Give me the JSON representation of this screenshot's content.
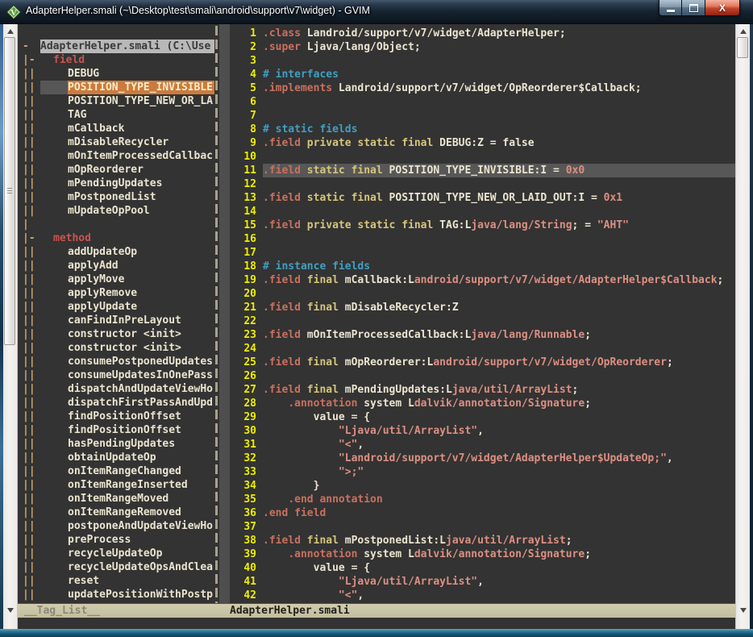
{
  "window": {
    "title": "AdapterHelper.smali (~\\Desktop\\test\\smali\\android\\support\\v7\\widget) - GVIM",
    "icon": "vim-icon",
    "buttons": {
      "minimize": "minimize",
      "maximize": "maximize",
      "close": "close"
    }
  },
  "colors": {
    "editor_bg": "#333333",
    "cursorline_bg": "#575757",
    "selected_tag_bg": "#cd7b3c",
    "statusbar_bg": "#c9c3a6",
    "line_number": "#eded00",
    "keyword": "#c9705f",
    "declaration": "#d6c57b",
    "plain_text": "#eae4cf",
    "comment": "#419ec1",
    "string_type": "#dc8f82",
    "fold_marker": "#cfa671",
    "group_label": "#c75450",
    "close_button": "#c04329"
  },
  "statusbar": {
    "left": "__Tag_List__",
    "file": "AdapterHelper.smali"
  },
  "taglist": {
    "rows": [
      {
        "fold": "-",
        "style": "header",
        "label": "AdapterHelper.smali (C:\\Use"
      },
      {
        "fold": "|-",
        "style": "group",
        "label": "field"
      },
      {
        "fold": "||",
        "style": "item",
        "label": "DEBUG"
      },
      {
        "fold": "||",
        "style": "item",
        "label": "POSITION_TYPE_INVISIBLE",
        "selected": true
      },
      {
        "fold": "||",
        "style": "item",
        "label": "POSITION_TYPE_NEW_OR_LA"
      },
      {
        "fold": "||",
        "style": "item",
        "label": "TAG"
      },
      {
        "fold": "||",
        "style": "item",
        "label": "mCallback"
      },
      {
        "fold": "||",
        "style": "item",
        "label": "mDisableRecycler"
      },
      {
        "fold": "||",
        "style": "item",
        "label": "mOnItemProcessedCallbac"
      },
      {
        "fold": "||",
        "style": "item",
        "label": "mOpReorderer"
      },
      {
        "fold": "||",
        "style": "item",
        "label": "mPendingUpdates"
      },
      {
        "fold": "||",
        "style": "item",
        "label": "mPostponedList"
      },
      {
        "fold": "||",
        "style": "item",
        "label": "mUpdateOpPool"
      },
      {
        "fold": "|",
        "style": "item",
        "label": ""
      },
      {
        "fold": "|-",
        "style": "group",
        "label": "method"
      },
      {
        "fold": "||",
        "style": "item",
        "label": "addUpdateOp"
      },
      {
        "fold": "||",
        "style": "item",
        "label": "applyAdd"
      },
      {
        "fold": "||",
        "style": "item",
        "label": "applyMove"
      },
      {
        "fold": "||",
        "style": "item",
        "label": "applyRemove"
      },
      {
        "fold": "||",
        "style": "item",
        "label": "applyUpdate"
      },
      {
        "fold": "||",
        "style": "item",
        "label": "canFindInPreLayout"
      },
      {
        "fold": "||",
        "style": "item",
        "label": "constructor <init>"
      },
      {
        "fold": "||",
        "style": "item",
        "label": "constructor <init>"
      },
      {
        "fold": "||",
        "style": "item",
        "label": "consumePostponedUpdates"
      },
      {
        "fold": "||",
        "style": "item",
        "label": "consumeUpdatesInOnePass"
      },
      {
        "fold": "||",
        "style": "item",
        "label": "dispatchAndUpdateViewHo"
      },
      {
        "fold": "||",
        "style": "item",
        "label": "dispatchFirstPassAndUpd"
      },
      {
        "fold": "||",
        "style": "item",
        "label": "findPositionOffset"
      },
      {
        "fold": "||",
        "style": "item",
        "label": "findPositionOffset"
      },
      {
        "fold": "||",
        "style": "item",
        "label": "hasPendingUpdates"
      },
      {
        "fold": "||",
        "style": "item",
        "label": "obtainUpdateOp"
      },
      {
        "fold": "||",
        "style": "item",
        "label": "onItemRangeChanged"
      },
      {
        "fold": "||",
        "style": "item",
        "label": "onItemRangeInserted"
      },
      {
        "fold": "||",
        "style": "item",
        "label": "onItemRangeMoved"
      },
      {
        "fold": "||",
        "style": "item",
        "label": "onItemRangeRemoved"
      },
      {
        "fold": "||",
        "style": "item",
        "label": "postponeAndUpdateViewHo"
      },
      {
        "fold": "||",
        "style": "item",
        "label": "preProcess"
      },
      {
        "fold": "||",
        "style": "item",
        "label": "recycleUpdateOp"
      },
      {
        "fold": "||",
        "style": "item",
        "label": "recycleUpdateOpsAndClea"
      },
      {
        "fold": "||",
        "style": "item",
        "label": "reset"
      },
      {
        "fold": "||",
        "style": "item",
        "label": "updatePositionWithPostp"
      }
    ]
  },
  "editor": {
    "lines": [
      {
        "n": 1,
        "seg": [
          [
            "k",
            ".class"
          ],
          [
            "p",
            " Landroid/support/v7/widget/AdapterHelper;"
          ]
        ]
      },
      {
        "n": 2,
        "seg": [
          [
            "k",
            ".super"
          ],
          [
            "p",
            " Ljava/lang/Object;"
          ]
        ]
      },
      {
        "n": 3,
        "seg": []
      },
      {
        "n": 4,
        "seg": [
          [
            "c",
            "# interfaces"
          ]
        ]
      },
      {
        "n": 5,
        "seg": [
          [
            "k",
            ".implements"
          ],
          [
            "p",
            " Landroid/support/v7/widget/OpReorderer$Callback;"
          ]
        ]
      },
      {
        "n": 6,
        "seg": []
      },
      {
        "n": 7,
        "seg": []
      },
      {
        "n": 8,
        "seg": [
          [
            "c",
            "# static fields"
          ]
        ]
      },
      {
        "n": 9,
        "seg": [
          [
            "k",
            ".field"
          ],
          [
            "b",
            " private static final"
          ],
          [
            "p",
            " DEBUG:Z = false"
          ]
        ]
      },
      {
        "n": 10,
        "seg": []
      },
      {
        "n": 11,
        "cursor": true,
        "seg": [
          [
            "k",
            ".field"
          ],
          [
            "b",
            " static final"
          ],
          [
            "p",
            " POSITION_TYPE_INVISIBLE:I = "
          ],
          [
            "s",
            "0x0"
          ]
        ]
      },
      {
        "n": 12,
        "seg": []
      },
      {
        "n": 13,
        "seg": [
          [
            "k",
            ".field"
          ],
          [
            "b",
            " static final"
          ],
          [
            "p",
            " POSITION_TYPE_NEW_OR_LAID_OUT:I = "
          ],
          [
            "s",
            "0x1"
          ]
        ]
      },
      {
        "n": 14,
        "seg": []
      },
      {
        "n": 15,
        "seg": [
          [
            "k",
            ".field"
          ],
          [
            "b",
            " private static final"
          ],
          [
            "p",
            " TAG:L"
          ],
          [
            "s",
            "java/lang/String"
          ],
          [
            "p",
            "; = "
          ],
          [
            "s",
            "\"AHT\""
          ]
        ]
      },
      {
        "n": 16,
        "seg": []
      },
      {
        "n": 17,
        "seg": []
      },
      {
        "n": 18,
        "seg": [
          [
            "c",
            "# instance fields"
          ]
        ]
      },
      {
        "n": 19,
        "seg": [
          [
            "k",
            ".field"
          ],
          [
            "b",
            " final"
          ],
          [
            "p",
            " mCallback:L"
          ],
          [
            "s",
            "android/support/v7/widget/AdapterHelper$Callback"
          ],
          [
            "p",
            ";"
          ]
        ]
      },
      {
        "n": 20,
        "seg": []
      },
      {
        "n": 21,
        "seg": [
          [
            "k",
            ".field"
          ],
          [
            "b",
            " final"
          ],
          [
            "p",
            " mDisableRecycler:Z"
          ]
        ]
      },
      {
        "n": 22,
        "seg": []
      },
      {
        "n": 23,
        "seg": [
          [
            "k",
            ".field"
          ],
          [
            "p",
            " mOnItemProcessedCallback:L"
          ],
          [
            "s",
            "java/lang/Runnable"
          ],
          [
            "p",
            ";"
          ]
        ]
      },
      {
        "n": 24,
        "seg": []
      },
      {
        "n": 25,
        "seg": [
          [
            "k",
            ".field"
          ],
          [
            "b",
            " final"
          ],
          [
            "p",
            " mOpReorderer:L"
          ],
          [
            "s",
            "android/support/v7/widget/OpReorderer"
          ],
          [
            "p",
            ";"
          ]
        ]
      },
      {
        "n": 26,
        "seg": []
      },
      {
        "n": 27,
        "seg": [
          [
            "k",
            ".field"
          ],
          [
            "b",
            " final"
          ],
          [
            "p",
            " mPendingUpdates:L"
          ],
          [
            "s",
            "java/util/ArrayList"
          ],
          [
            "p",
            ";"
          ]
        ]
      },
      {
        "n": 28,
        "seg": [
          [
            "p",
            "    "
          ],
          [
            "k",
            ".annotation"
          ],
          [
            "p",
            " system L"
          ],
          [
            "s",
            "dalvik/annotation/Signature"
          ],
          [
            "p",
            ";"
          ]
        ]
      },
      {
        "n": 29,
        "seg": [
          [
            "p",
            "        value = {"
          ]
        ]
      },
      {
        "n": 30,
        "seg": [
          [
            "p",
            "            "
          ],
          [
            "s",
            "\"Ljava/util/ArrayList\""
          ],
          [
            "p",
            ","
          ]
        ]
      },
      {
        "n": 31,
        "seg": [
          [
            "p",
            "            "
          ],
          [
            "s",
            "\"<\""
          ],
          [
            "p",
            ","
          ]
        ]
      },
      {
        "n": 32,
        "seg": [
          [
            "p",
            "            "
          ],
          [
            "s",
            "\"Landroid/support/v7/widget/AdapterHelper$UpdateOp;\""
          ],
          [
            "p",
            ","
          ]
        ]
      },
      {
        "n": 33,
        "seg": [
          [
            "p",
            "            "
          ],
          [
            "s",
            "\">;\""
          ]
        ]
      },
      {
        "n": 34,
        "seg": [
          [
            "p",
            "        }"
          ]
        ]
      },
      {
        "n": 35,
        "seg": [
          [
            "p",
            "    "
          ],
          [
            "k",
            ".end annotation"
          ]
        ]
      },
      {
        "n": 36,
        "seg": [
          [
            "k",
            ".end field"
          ]
        ]
      },
      {
        "n": 37,
        "seg": []
      },
      {
        "n": 38,
        "seg": [
          [
            "k",
            ".field"
          ],
          [
            "b",
            " final"
          ],
          [
            "p",
            " mPostponedList:L"
          ],
          [
            "s",
            "java/util/ArrayList"
          ],
          [
            "p",
            ";"
          ]
        ]
      },
      {
        "n": 39,
        "seg": [
          [
            "p",
            "    "
          ],
          [
            "k",
            ".annotation"
          ],
          [
            "p",
            " system L"
          ],
          [
            "s",
            "dalvik/annotation/Signature"
          ],
          [
            "p",
            ";"
          ]
        ]
      },
      {
        "n": 40,
        "seg": [
          [
            "p",
            "        value = {"
          ]
        ]
      },
      {
        "n": 41,
        "seg": [
          [
            "p",
            "            "
          ],
          [
            "s",
            "\"Ljava/util/ArrayList\""
          ],
          [
            "p",
            ","
          ]
        ]
      },
      {
        "n": 42,
        "seg": [
          [
            "p",
            "            "
          ],
          [
            "s",
            "\"<\""
          ],
          [
            "p",
            ","
          ]
        ]
      }
    ]
  }
}
